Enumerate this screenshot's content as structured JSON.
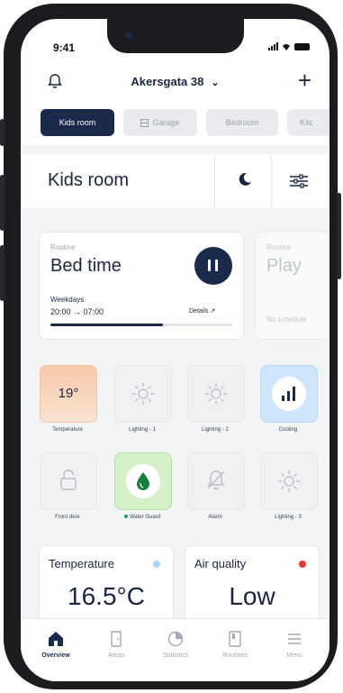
{
  "status": {
    "time": "9:41"
  },
  "header": {
    "location": "Akersgata 38"
  },
  "tabs": [
    {
      "label": "Kids room"
    },
    {
      "label": "Garage"
    },
    {
      "label": "Bedroom"
    },
    {
      "label": "Kitc"
    }
  ],
  "room": {
    "title": "Kids room"
  },
  "routines": [
    {
      "small": "Routine",
      "title": "Bed time",
      "schedule_label": "Weekdays",
      "schedule": "20:00 → 07:00",
      "details": "Details ↗",
      "progress": 0.62
    },
    {
      "small": "Routine",
      "title": "Play",
      "status": "No schedule"
    }
  ],
  "tiles": [
    {
      "label": "Temperature",
      "value": "19°",
      "icon": "temperature-icon"
    },
    {
      "label": "Lighting - 1",
      "icon": "light-icon"
    },
    {
      "label": "Lighting - 2",
      "icon": "light-icon"
    },
    {
      "label": "Cooling",
      "icon": "bars-icon"
    },
    {
      "label": "Front door",
      "icon": "lock-icon"
    },
    {
      "label": "Water Guard",
      "icon": "water-drop-icon",
      "status_dot": "#16a34a"
    },
    {
      "label": "Alarm",
      "icon": "bell-off-icon"
    },
    {
      "label": "Lighting - 3",
      "icon": "light-icon"
    }
  ],
  "stats": [
    {
      "title": "Temperature",
      "value": "16.5°C",
      "dot_color": "#a8d4f5"
    },
    {
      "title": "Air quality",
      "value": "Low",
      "dot_color": "#e53935"
    }
  ],
  "nav": [
    {
      "label": "Overview",
      "icon": "home-icon",
      "active": true
    },
    {
      "label": "Areas",
      "icon": "door-icon"
    },
    {
      "label": "Statistics",
      "icon": "pie-chart-icon"
    },
    {
      "label": "Routines",
      "icon": "routine-icon"
    },
    {
      "label": "Menu",
      "icon": "menu-icon"
    }
  ],
  "colors": {
    "primary": "#1b2a4a",
    "temperature_tile": "#f6c9a8",
    "water_tile": "#d6f0c9",
    "cooling_tile": "#cfe5fb"
  }
}
